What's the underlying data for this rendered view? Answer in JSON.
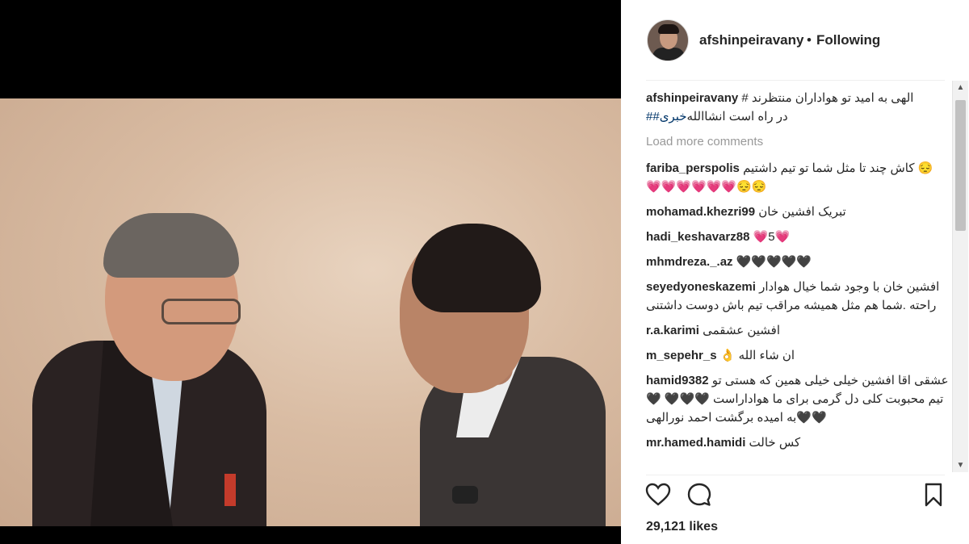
{
  "header": {
    "username": "afshinpeiravany",
    "separator": "•",
    "follow_status": "Following"
  },
  "caption": {
    "username": "afshinpeiravany",
    "text_line1": "الهی به امید تو هواداران منتظرند #",
    "hashtag": "##خبری",
    "text_line2": " در راه است انشاالله"
  },
  "load_more": "Load more comments",
  "comments": [
    {
      "user": "fariba_perspolis",
      "text": "😔 کاش چند تا مثل شما تو تیم داشتیم 😔😔💗💗💗💗💗💗"
    },
    {
      "user": "mohamad.khezri99",
      "text": "تبریک افشین خان"
    },
    {
      "user": "hadi_keshavarz88",
      "text": "💗5💗"
    },
    {
      "user": "mhmdreza._.az",
      "text": "🖤🖤🖤🖤🖤"
    },
    {
      "user": "seyedyoneskazemi",
      "text": "افشین خان با وجود شما خیال هوادار راحته .شما هم مثل همیشه مراقب تیم باش دوست داشتنی"
    },
    {
      "user": "r.a.karimi",
      "text": "افشین عشقمی"
    },
    {
      "user": "m_sepehr_s",
      "text": "ان شاء الله 👌"
    },
    {
      "user": "hamid9382",
      "text": "عشقی اقا افشین خیلی خیلی همین که هستی تو تیم محبوبت کلی دل گرمی برای ما هواداراست 🖤🖤🖤 🖤🖤🖤به امیده برگشت احمد نورالهی"
    },
    {
      "user": "mr.hamed.hamidi",
      "text": "کس خالت"
    }
  ],
  "likes": "29,121 likes",
  "icons": {
    "like": "heart-icon",
    "comment": "comment-icon",
    "save": "bookmark-icon"
  }
}
